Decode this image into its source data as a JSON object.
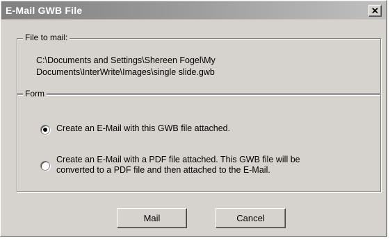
{
  "window": {
    "title": "E-Mail GWB File",
    "close_glyph": "✕"
  },
  "file_group": {
    "legend": "File to mail:",
    "path_line1": "C:\\Documents and Settings\\Shereen Fogel\\My",
    "path_line2": "Documents\\InterWrite\\Images\\single slide.gwb"
  },
  "form_group": {
    "legend": "Form",
    "options": [
      {
        "line1": "Create an E-Mail with this GWB file attached.",
        "line2": "",
        "checked": true
      },
      {
        "line1": "Create an E-Mail with a PDF file attached.  This GWB file will be",
        "line2": "converted to a PDF file and then attached to the E-Mail.",
        "checked": false
      }
    ]
  },
  "buttons": {
    "mail_label": "Mail",
    "cancel_label": "Cancel"
  }
}
